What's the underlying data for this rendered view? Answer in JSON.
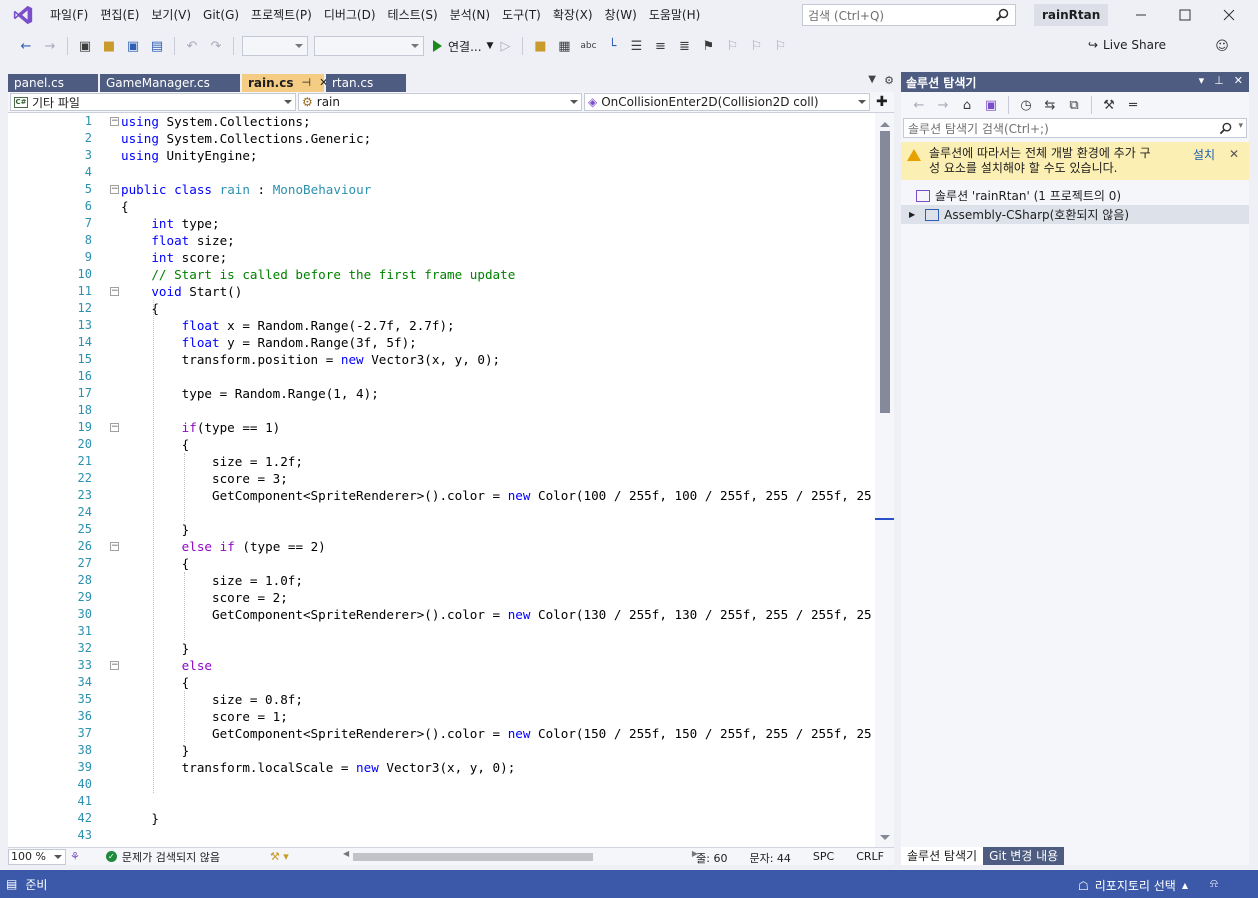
{
  "menu": {
    "items": [
      "파일(F)",
      "편집(E)",
      "보기(V)",
      "Git(G)",
      "프로젝트(P)",
      "디버그(D)",
      "테스트(S)",
      "분석(N)",
      "도구(T)",
      "확장(X)",
      "창(W)",
      "도움말(H)"
    ],
    "search_placeholder": "검색 (Ctrl+Q)",
    "solution_name": "rainRtan"
  },
  "toolbar": {
    "run_label": "연결...",
    "live_share": "Live Share"
  },
  "tabs": [
    {
      "label": "panel.cs",
      "active": false
    },
    {
      "label": "GameManager.cs",
      "active": false
    },
    {
      "label": "rain.cs",
      "active": true
    },
    {
      "label": "rtan.cs",
      "active": false
    }
  ],
  "nav": {
    "project": "기타 파일",
    "class": "rain",
    "member": "OnCollisionEnter2D(Collision2D coll)"
  },
  "code_lines": [
    "using System.Collections;",
    "using System.Collections.Generic;",
    "using UnityEngine;",
    "",
    "public class rain : MonoBehaviour",
    "{",
    "    int type;",
    "    float size;",
    "    int score;",
    "    // Start is called before the first frame update",
    "    void Start()",
    "    {",
    "        float x = Random.Range(-2.7f, 2.7f);",
    "        float y = Random.Range(3f, 5f);",
    "        transform.position = new Vector3(x, y, 0);",
    "",
    "        type = Random.Range(1, 4);",
    "",
    "        if(type == 1)",
    "        {",
    "            size = 1.2f;",
    "            score = 3;",
    "            GetComponent<SpriteRenderer>().color = new Color(100 / 255f, 100 / 255f, 255 / 255f, 25",
    "",
    "        }",
    "        else if (type == 2)",
    "        {",
    "            size = 1.0f;",
    "            score = 2;",
    "            GetComponent<SpriteRenderer>().color = new Color(130 / 255f, 130 / 255f, 255 / 255f, 25",
    "",
    "        }",
    "        else",
    "        {",
    "            size = 0.8f;",
    "            score = 1;",
    "            GetComponent<SpriteRenderer>().color = new Color(150 / 255f, 150 / 255f, 255 / 255f, 25",
    "        }",
    "        transform.localScale = new Vector3(x, y, 0);",
    "",
    "",
    "    }",
    ""
  ],
  "editor_status": {
    "zoom": "100 %",
    "issues": "문제가 검색되지 않음",
    "line": "줄: 60",
    "char": "문자: 44",
    "spc": "SPC",
    "crlf": "CRLF"
  },
  "solution_explorer": {
    "title": "솔루션 탐색기",
    "search_placeholder": "솔루션 탐색기 검색(Ctrl+;)",
    "warning_text_1": "솔루션에 따라서는 전체 개발 환경에 추가 구",
    "warning_text_2": "성 요소를 설치해야 할 수도 있습니다.",
    "install_label": "설치",
    "solution_row": "솔루션 'rainRtan'  (1 프로젝트의 0)",
    "project_row": "Assembly-CSharp(호환되지 않음)",
    "bottom_tab_1": "솔루션 탐색기",
    "bottom_tab_2": "Git 변경 내용"
  },
  "status": {
    "ready": "준비",
    "repo": "리포지토리 선택"
  },
  "colors": {
    "accent": "#3b59a8",
    "panel_header": "#4d5c80",
    "active_tab": "#f5cc84",
    "keyword": "#0000ff",
    "type": "#2b91af",
    "comment": "#008000",
    "control": "#8f08c4"
  }
}
